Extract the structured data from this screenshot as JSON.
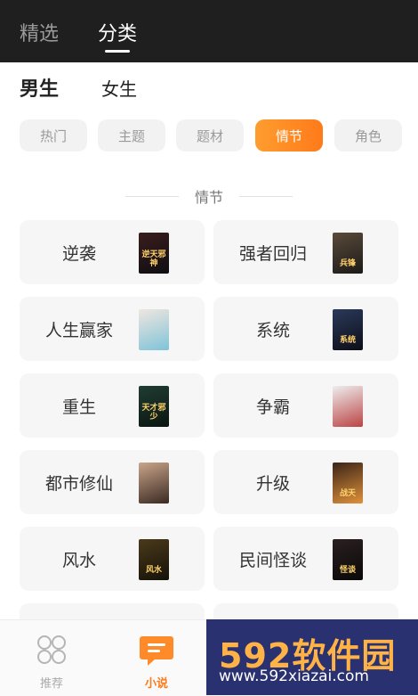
{
  "top_tabs": [
    {
      "label": "精选"
    },
    {
      "label": "分类"
    }
  ],
  "gender_tabs": [
    {
      "label": "男生"
    },
    {
      "label": "女生"
    }
  ],
  "category_chips": [
    {
      "label": "热门"
    },
    {
      "label": "主题"
    },
    {
      "label": "题材"
    },
    {
      "label": "情节"
    },
    {
      "label": "角色"
    }
  ],
  "section": {
    "title": "情节"
  },
  "cards": [
    {
      "label": "逆袭",
      "cover_text": "逆天邪神",
      "cover_colors": [
        "#3b1d1d",
        "#0e0e12"
      ]
    },
    {
      "label": "强者回归",
      "cover_text": "兵锋",
      "cover_colors": [
        "#5a4a3a",
        "#1c1a18"
      ]
    },
    {
      "label": "人生赢家",
      "cover_text": "",
      "cover_colors": [
        "#f0e6df",
        "#7fc3d8"
      ]
    },
    {
      "label": "系统",
      "cover_text": "系统",
      "cover_colors": [
        "#2a3a5a",
        "#0d0d18"
      ]
    },
    {
      "label": "重生",
      "cover_text": "天才邪少",
      "cover_colors": [
        "#1f3d33",
        "#0b1510"
      ]
    },
    {
      "label": "争霸",
      "cover_text": "",
      "cover_colors": [
        "#eeeeee",
        "#b44"
      ]
    },
    {
      "label": "都市修仙",
      "cover_text": "",
      "cover_colors": [
        "#c9a58a",
        "#3a2a22"
      ]
    },
    {
      "label": "升级",
      "cover_text": "战天",
      "cover_colors": [
        "#3a2418",
        "#e0913a"
      ]
    },
    {
      "label": "风水",
      "cover_text": "风水",
      "cover_colors": [
        "#4a3a1a",
        "#151209"
      ]
    },
    {
      "label": "民间怪谈",
      "cover_text": "怪谈",
      "cover_colors": [
        "#2a2020",
        "#0a0808"
      ]
    }
  ],
  "bottom_nav": [
    {
      "label": "推荐",
      "icon": "grid-icon"
    },
    {
      "label": "小说",
      "icon": "book-chat-icon"
    }
  ],
  "watermark": {
    "title": "592软件园",
    "url": "www.592xiazai.com"
  },
  "colors": {
    "accent": "#ff7a1a",
    "top_bar": "#1f1f1f",
    "card_bg": "#f6f6f6"
  }
}
